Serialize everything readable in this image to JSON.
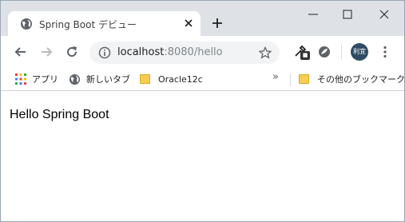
{
  "tab": {
    "title": "Spring Boot デビュー",
    "favicon": "globe-icon"
  },
  "window_controls": [
    "minimize-icon",
    "maximize-icon",
    "close-icon"
  ],
  "toolbar": {
    "url_host": "localhost",
    "url_rest": ":8080/hello",
    "avatar_text": "利宜"
  },
  "bookmarks": {
    "items": [
      {
        "label": "アプリ",
        "icon": "apps-grid-icon"
      },
      {
        "label": "新しいタブ",
        "icon": "globe-icon"
      },
      {
        "label": "Oracle12c",
        "icon": "folder-icon"
      }
    ],
    "overflow": "»",
    "other": "その他のブックマーク"
  },
  "page": {
    "text": "Hello Spring Boot"
  },
  "colors": {
    "tabstrip_bg": "#dee1e6",
    "omnibox_bg": "#f1f3f4",
    "folder": "#f7cd4f",
    "avatar": "#2f4c64"
  }
}
